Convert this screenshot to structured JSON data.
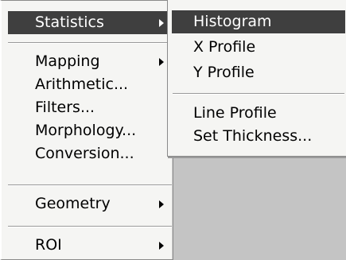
{
  "main_menu": {
    "items": [
      {
        "label": "Statistics",
        "has_submenu": true,
        "highlighted": true
      },
      {
        "label": "Mapping",
        "has_submenu": true
      },
      {
        "label": "Arithmetic..."
      },
      {
        "label": "Filters..."
      },
      {
        "label": "Morphology..."
      },
      {
        "label": "Conversion..."
      },
      {
        "label": "Geometry",
        "has_submenu": true
      },
      {
        "label": "ROI",
        "has_submenu": true
      }
    ]
  },
  "submenu": {
    "items": [
      {
        "label": "Histogram",
        "highlighted": true
      },
      {
        "label": "X Profile"
      },
      {
        "label": "Y Profile"
      },
      {
        "label": "Line Profile"
      },
      {
        "label": "Set Thickness..."
      }
    ]
  },
  "colors": {
    "highlight_bg": "#3f3f3f",
    "highlight_text": "#ffffff",
    "menu_bg": "#f5f5f3",
    "workspace_bg": "#c4c4c4"
  },
  "icons": {
    "submenu_arrow": "chevron-right-icon"
  }
}
